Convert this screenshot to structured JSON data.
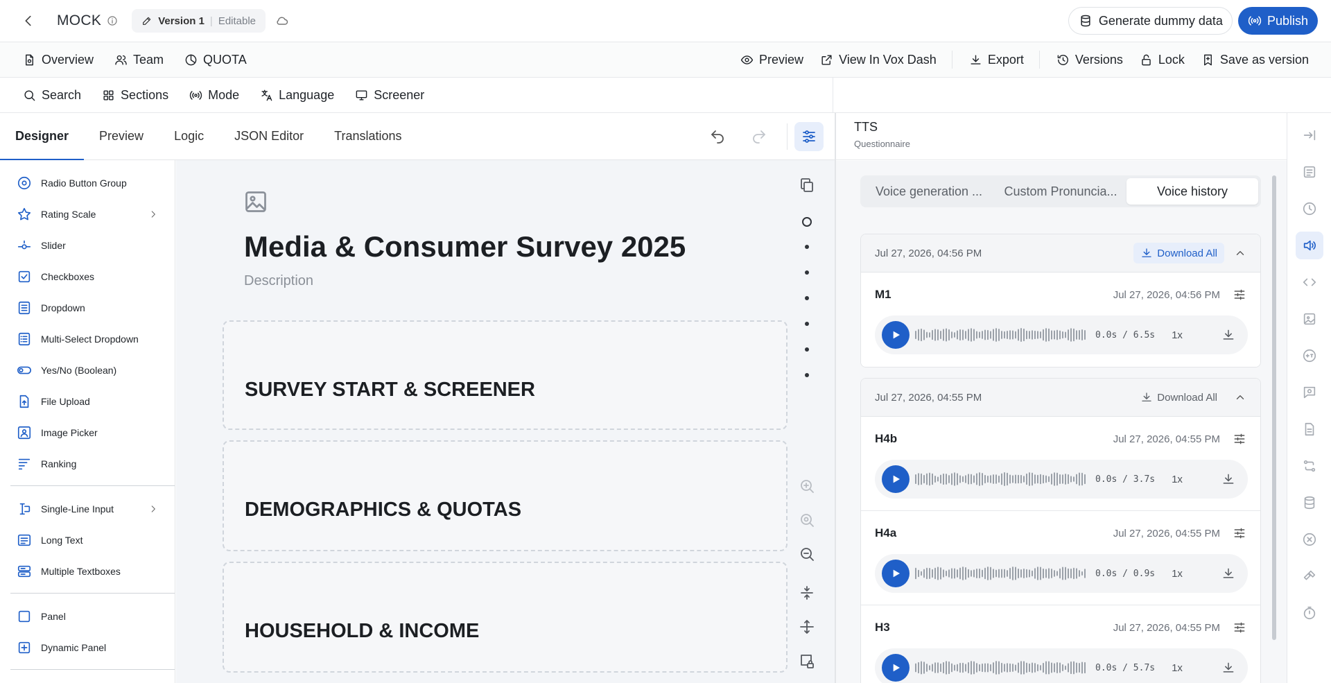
{
  "header": {
    "app_title": "MOCK",
    "version_name": "Version 1",
    "version_state": "Editable",
    "generate_label": "Generate dummy data",
    "publish_label": "Publish"
  },
  "toolbar1": {
    "left": [
      {
        "label": "Overview",
        "icon": "file-icon"
      },
      {
        "label": "Team",
        "icon": "team-icon"
      },
      {
        "label": "QUOTA",
        "icon": "pie-chart-icon"
      }
    ],
    "right": [
      {
        "label": "Preview",
        "icon": "eye-icon"
      },
      {
        "label": "View In Vox Dash",
        "icon": "external-link-icon"
      },
      {
        "label": "Export",
        "icon": "download-icon"
      },
      {
        "label": "Versions",
        "icon": "history-icon"
      },
      {
        "label": "Lock",
        "icon": "lock-icon"
      },
      {
        "label": "Save as version",
        "icon": "bookmark-icon"
      }
    ]
  },
  "toolbar2": [
    {
      "label": "Search",
      "icon": "search-icon"
    },
    {
      "label": "Sections",
      "icon": "grid-icon"
    },
    {
      "label": "Mode",
      "icon": "broadcast-icon"
    },
    {
      "label": "Language",
      "icon": "language-icon"
    },
    {
      "label": "Screener",
      "icon": "monitor-icon"
    }
  ],
  "designer_tabs": [
    "Designer",
    "Preview",
    "Logic",
    "JSON Editor",
    "Translations"
  ],
  "toolbox": {
    "group1": [
      "Radio Button Group",
      "Rating Scale",
      "Slider",
      "Checkboxes",
      "Dropdown",
      "Multi-Select Dropdown",
      "Yes/No (Boolean)",
      "File Upload",
      "Image Picker",
      "Ranking"
    ],
    "group2": [
      "Single-Line Input",
      "Long Text",
      "Multiple Textboxes"
    ],
    "group3": [
      "Panel",
      "Dynamic Panel"
    ]
  },
  "survey": {
    "title": "Media & Consumer Survey 2025",
    "description_placeholder": "Description",
    "pages": [
      "SURVEY START & SCREENER",
      "DEMOGRAPHICS & QUOTAS",
      "HOUSEHOLD & INCOME"
    ]
  },
  "right_panel": {
    "title": "TTS",
    "subtitle": "Questionnaire",
    "tabs": [
      "Voice generation ...",
      "Custom Pronuncia...",
      "Voice history"
    ],
    "active_tab": "Voice history",
    "download_all_label": "Download All",
    "groups": [
      {
        "date": "Jul 27, 2026, 04:56 PM",
        "clips": [
          {
            "name": "M1",
            "date": "Jul 27, 2026, 04:56 PM",
            "time": "0.0s / 6.5s",
            "speed": "1x"
          }
        ]
      },
      {
        "date": "Jul 27, 2026, 04:55 PM",
        "clips": [
          {
            "name": "H4b",
            "date": "Jul 27, 2026, 04:55 PM",
            "time": "0.0s / 3.7s",
            "speed": "1x"
          },
          {
            "name": "H4a",
            "date": "Jul 27, 2026, 04:55 PM",
            "time": "0.0s / 0.9s",
            "speed": "1x"
          },
          {
            "name": "H3",
            "date": "Jul 27, 2026, 04:55 PM",
            "time": "0.0s / 5.7s",
            "speed": "1x"
          }
        ]
      }
    ]
  },
  "colors": {
    "accent": "#1f5fc8",
    "accent_light": "#e7eefb"
  }
}
